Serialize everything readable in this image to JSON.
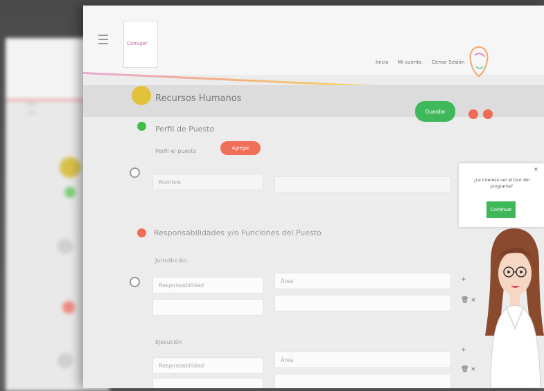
{
  "header": {
    "logo_text": "Comujer",
    "nav": [
      "Inicio",
      "Mi cuenta",
      "Cerrar Sesión"
    ]
  },
  "section": {
    "title": "Recursos Humanos",
    "save_label": "Guardar"
  },
  "perfil": {
    "title": "Perfil de Puesto",
    "field_label": "Perfil el puesto",
    "add_label": "Agregar",
    "input_placeholder": "Nombre"
  },
  "responsabilidades": {
    "title": "Responsabilidades y/o Funciones del Puesto",
    "group1_label": "Jurisdicción",
    "group1_left_placeholder": "Responsabilidad",
    "group1_right_placeholder": "Área",
    "group2_label": "Ejecución",
    "group2_left_placeholder": "Responsabilidad",
    "group2_right_placeholder": "Área"
  },
  "popup": {
    "text": "¿Le interesa ver el tour del programa?",
    "button_label": "Continuar",
    "close": "×"
  },
  "colors": {
    "accent_green": "#3fb85a",
    "accent_red": "#f06a55",
    "accent_yellow": "#e3c23b"
  }
}
